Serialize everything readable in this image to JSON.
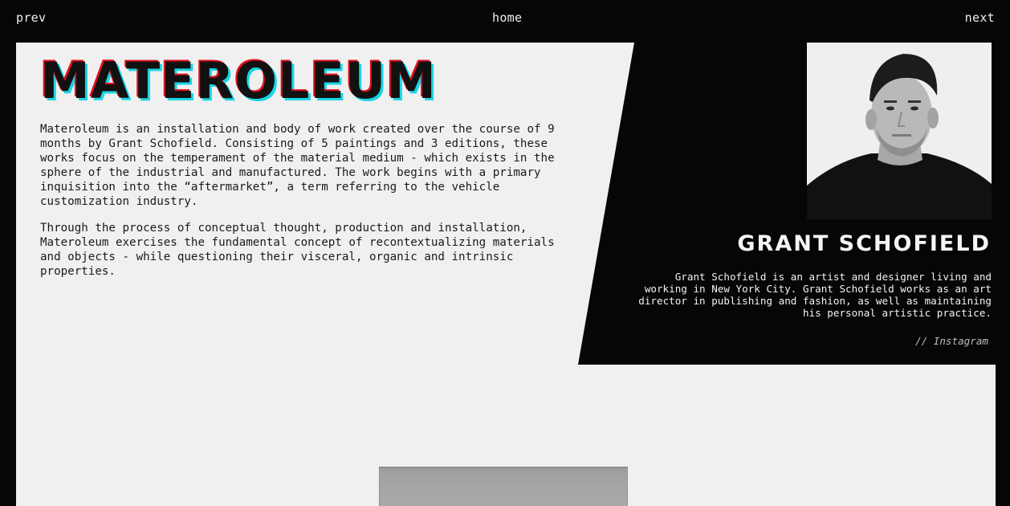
{
  "nav": {
    "prev": "prev",
    "home": "home",
    "next": "next"
  },
  "project": {
    "title": "MATEROLEUM",
    "paragraphs": [
      "Materoleum is an installation and body of work created over the course of 9 months by Grant Schofield. Consisting of 5 paintings and 3 editions, these works focus on the temperament of the material medium - which exists in the sphere of the industrial and manufactured. The work begins with a primary inquisition into the “aftermarket”, a term referring to the vehicle customization industry.",
      "Through the process of conceptual thought, production and installation, Materoleum exercises the fundamental concept of recontextualizing materials and objects - while questioning their visceral, organic and intrinsic properties."
    ]
  },
  "artist": {
    "name": "GRANT SCHOFIELD",
    "bio": "Grant Schofield is an artist and designer living and working in New York City. Grant Schofield works as an art director in publishing and fashion, as well as maintaining his personal artistic practice.",
    "link": "// Instagram"
  },
  "colors": {
    "background": "#060606",
    "page": "#f0f0f0",
    "title_shadow_red": "#e1101f",
    "title_shadow_cyan": "#19d6e6"
  }
}
